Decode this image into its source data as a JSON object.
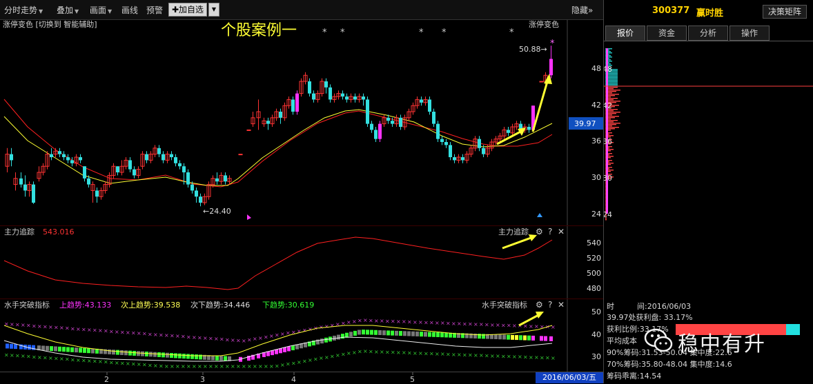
{
  "toolbar": {
    "items": [
      {
        "label": "分时走势",
        "caret": true
      },
      {
        "label": "叠加",
        "caret": true
      },
      {
        "label": "画面",
        "caret": true
      },
      {
        "label": "画线",
        "caret": false
      },
      {
        "label": "预警",
        "caret": false
      }
    ],
    "add_label": "✚加自选",
    "hide_label": "隐藏",
    "caret_glyph": "▼",
    "hide_glyph": "»"
  },
  "main": {
    "formula_left": "涨停变色 [切换到 智能辅助]",
    "formula_right": "涨停变色",
    "annotation": "个股案例一",
    "high_label": "50.88→",
    "low_label": "←24.40",
    "price_ticks": [
      "48",
      "42",
      "36",
      "30",
      "24"
    ],
    "current_price": "39.97",
    "star": "*"
  },
  "sub1": {
    "title": "主力追踪",
    "value": "543.016",
    "right_title": "主力追踪",
    "ticks": [
      "540",
      "520",
      "500",
      "480"
    ]
  },
  "sub2": {
    "title": "水手突破指标",
    "items": [
      {
        "label": "上趋势:43.133",
        "color": "#ff33ff"
      },
      {
        "label": "次上趋势:39.538",
        "color": "#ffff55"
      },
      {
        "label": "次下趋势:34.446",
        "color": "#dddddd"
      },
      {
        "label": "下趋势:30.619",
        "color": "#33ff33"
      }
    ],
    "right_title": "水手突破指标",
    "ticks": [
      "50",
      "40",
      "30"
    ]
  },
  "panel_controls": {
    "gear": "⚙",
    "help": "?",
    "close": "✕"
  },
  "xaxis": {
    "labels": [
      "2",
      "3",
      "4",
      "5"
    ],
    "date": "2016/06/03/五"
  },
  "right": {
    "code": "300377",
    "name": "赢时胜",
    "decide_label": "决策矩阵",
    "tabs": [
      "报价",
      "资金",
      "分析",
      "操作"
    ],
    "active_tab": 0,
    "chip_ticks": [
      "48",
      "42",
      "36",
      "30",
      "24"
    ],
    "info": [
      "时　　　间:2016/06/03",
      "39.97处获利盘: 33.17%",
      "获利比例:33.17%",
      "平均成本",
      "90%筹码:31.53-50.04 集中度:22.6",
      "70%筹码:35.80-48.04 集中度:14.6",
      "筹码乖离:14.54"
    ],
    "watermark": "稳中有升"
  },
  "colors": {
    "up": "#ff3333",
    "down": "#33e0e0",
    "limit_up": "#ff33ff",
    "ma_yellow": "#ffff33",
    "ma_red": "#ff2020",
    "arrow": "#ffff33"
  }
}
